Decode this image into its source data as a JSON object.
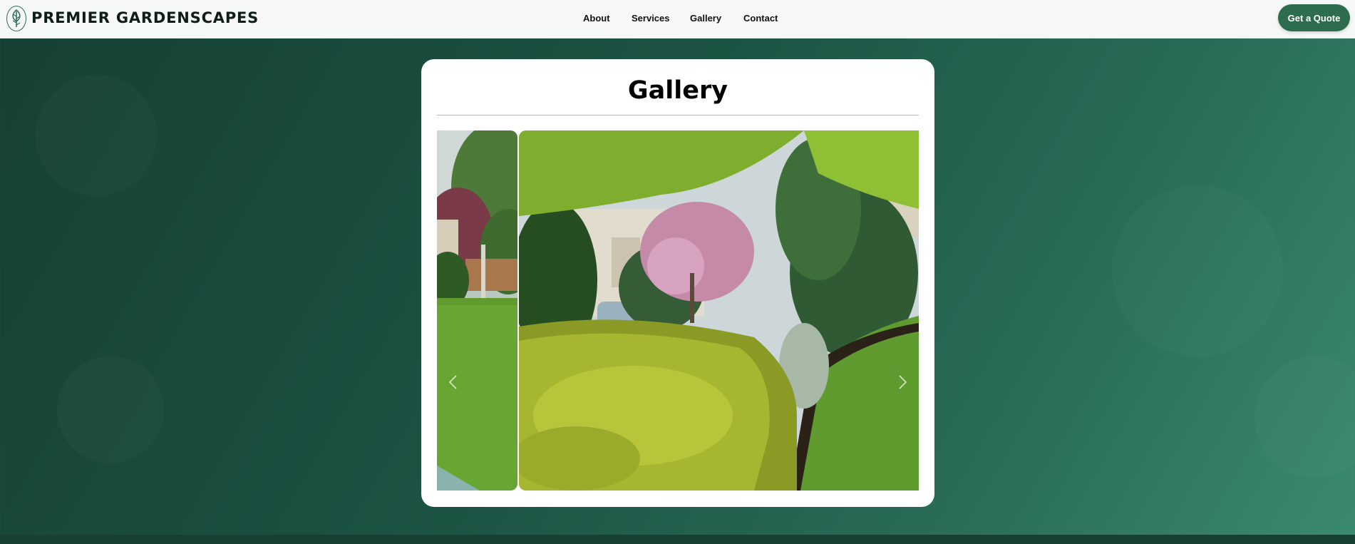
{
  "brand": {
    "name": "PREMIER GARDENSCAPES",
    "logo_icon": "leaf-emblem-icon",
    "color": "#2e6a55"
  },
  "nav": {
    "items": [
      {
        "label": "About"
      },
      {
        "label": "Services"
      },
      {
        "label": "Gallery"
      },
      {
        "label": "Contact"
      }
    ]
  },
  "cta": {
    "label": "Get a Quote",
    "color": "#2e6c50"
  },
  "gallery": {
    "title": "Gallery",
    "slides": [
      {
        "description": "lawn with birch tree and wooden fence"
      },
      {
        "description": "garden bed with golden juniper, flowering magnolia and evergreens"
      }
    ],
    "prev_icon": "chevron-left-icon",
    "next_icon": "chevron-right-icon",
    "active_slide": 2
  },
  "colors": {
    "background_start": "#163f33",
    "background_end": "#3a8a70",
    "card": "#ffffff"
  }
}
